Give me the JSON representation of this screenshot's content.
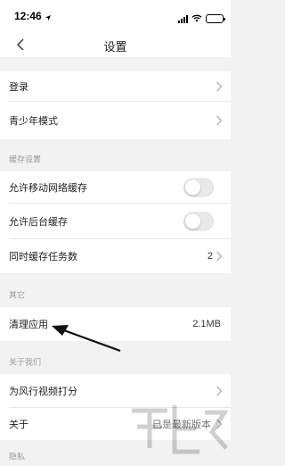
{
  "status_bar": {
    "time": "12:46",
    "icons": [
      "location-arrow-icon",
      "signal-icon",
      "wifi-icon",
      "battery-icon"
    ]
  },
  "nav": {
    "title": "设置",
    "back_icon": "chevron-left-icon"
  },
  "account": {
    "login_label": "登录",
    "youth_mode_label": "青少年模式"
  },
  "cache_section": {
    "header": "缓存设置",
    "mobile_cache_label": "允许移动网络缓存",
    "mobile_cache_on": false,
    "background_cache_label": "允许后台缓存",
    "background_cache_on": false,
    "concurrent_tasks_label": "同时缓存任务数",
    "concurrent_tasks_value": "2"
  },
  "other_section": {
    "header": "其它",
    "clean_app_label": "清理应用",
    "clean_app_value": "2.1MB"
  },
  "about_section": {
    "header": "关于我们",
    "rate_label": "为风行视频打分",
    "about_label": "关于",
    "about_value": "已是最新版本"
  },
  "privacy_section": {
    "header": "隐私"
  },
  "colors": {
    "background": "#f2f2f2",
    "row": "#ffffff",
    "section_header_text": "#9a9a9a",
    "toggle_off": "#e9e9e9"
  }
}
